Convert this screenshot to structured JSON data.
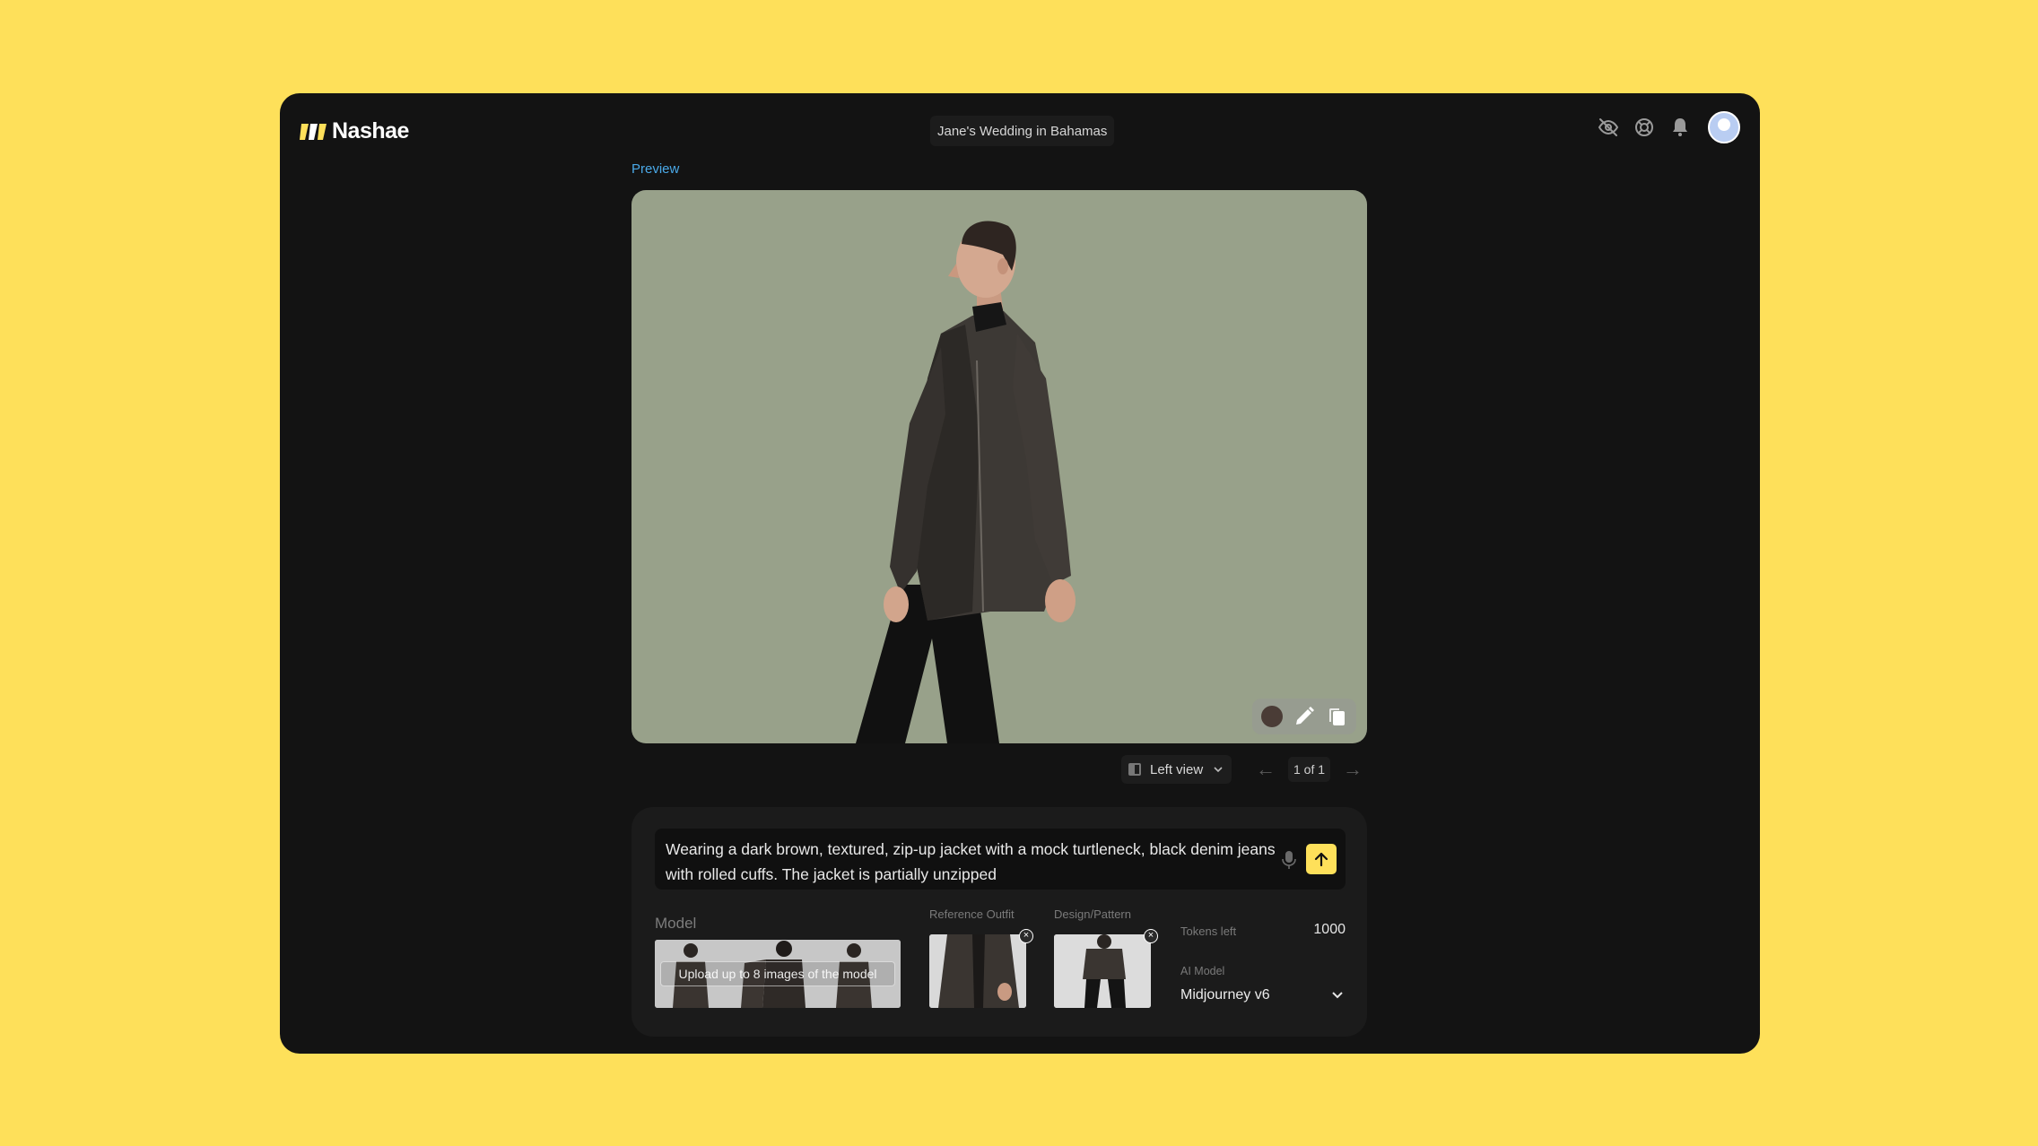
{
  "app": {
    "brand": "Nashae",
    "project_title": "Jane's Wedding in Bahamas",
    "accent_color": "#FEE05A",
    "link_color": "#4aa9e8"
  },
  "header": {
    "icons": [
      "eye-off-icon",
      "lifebuoy-icon",
      "bell-icon",
      "avatar"
    ]
  },
  "preview": {
    "label": "Preview",
    "toolbar_icons": [
      "color-swatch-icon",
      "pencil-icon",
      "copy-icon"
    ],
    "view_select": "Left view",
    "pager": "1 of 1"
  },
  "composer": {
    "prompt": "Wearing a dark brown, textured, zip-up jacket with a mock turtleneck, black denim jeans with rolled cuffs. The jacket is partially unzipped",
    "model_label": "Model",
    "model_upload_hint": "Upload up to 8 images of the model",
    "reference_label": "Reference Outfit",
    "design_label": "Design/Pattern",
    "tokens_label": "Tokens left",
    "tokens_value": "1000",
    "ai_model_label": "AI Model",
    "ai_model_value": "Midjourney v6"
  }
}
